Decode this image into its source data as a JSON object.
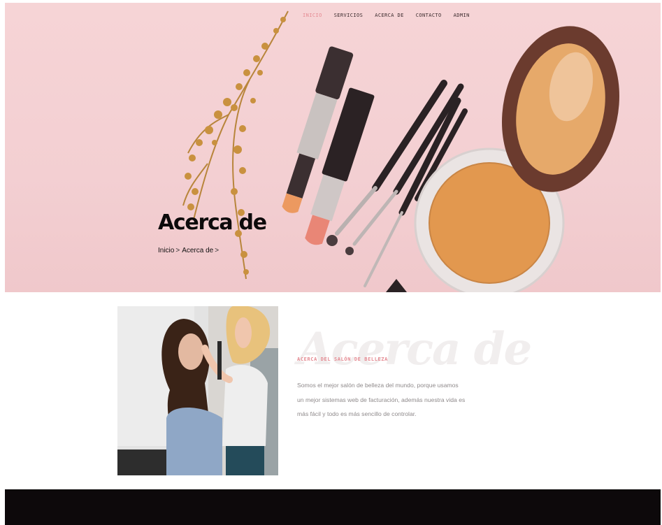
{
  "nav": {
    "items": [
      {
        "label": "INICIO",
        "active": true
      },
      {
        "label": "SERVICIOS",
        "active": false
      },
      {
        "label": "ACERCA DE",
        "active": false
      },
      {
        "label": "CONTACTO",
        "active": false
      },
      {
        "label": "ADMIN",
        "active": false
      }
    ]
  },
  "hero": {
    "title": "Acerca de",
    "breadcrumb": {
      "home": "Inicio",
      "current": "Acerca de",
      "separator": ">"
    }
  },
  "about": {
    "watermark": "Acerca de",
    "subtitle": "ACERCA DEL SALÓN DE BELLEZA",
    "lines": [
      "Somos el mejor salón de belleza del mundo, porque usamos",
      "un mejor sistemas web de facturación, además nuestra vida es",
      "más fácil y todo es más sencillo de controlar."
    ]
  },
  "colors": {
    "accent": "#e58a92",
    "hero_bg": "#f5d2d4",
    "footer_bg": "#0d090b",
    "body_text": "#8f8a8b"
  }
}
